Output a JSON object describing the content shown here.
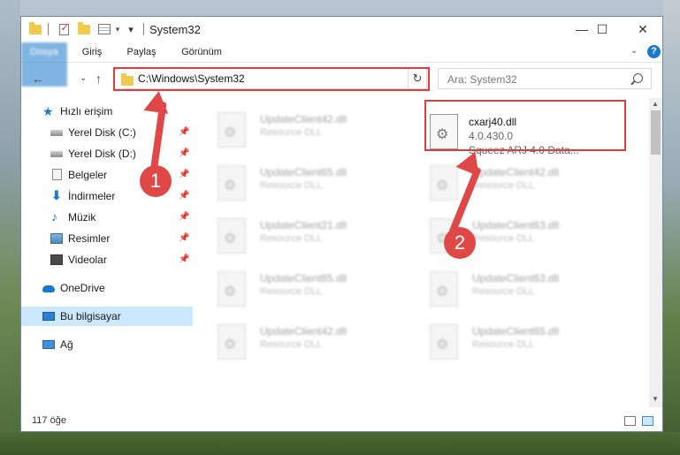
{
  "window": {
    "title": "System32"
  },
  "ribbon": {
    "tabs": [
      {
        "label": "Dosya"
      },
      {
        "label": "Giriş"
      },
      {
        "label": "Paylaş"
      },
      {
        "label": "Görünüm"
      }
    ],
    "help": "?"
  },
  "navigation": {
    "address": "C:\\Windows\\System32",
    "search_placeholder": "Ara: System32"
  },
  "sidebar": {
    "items": [
      {
        "label": "Hızlı erişim",
        "icon": "star-icon"
      },
      {
        "label": "Yerel Disk (C:)",
        "icon": "disk-icon",
        "pinned": true
      },
      {
        "label": "Yerel Disk (D:)",
        "icon": "disk-icon",
        "pinned": true
      },
      {
        "label": "Belgeler",
        "icon": "documents-icon",
        "pinned": true
      },
      {
        "label": "İndirmeler",
        "icon": "download-icon",
        "pinned": true
      },
      {
        "label": "Müzik",
        "icon": "music-icon",
        "pinned": true
      },
      {
        "label": "Resimler",
        "icon": "pictures-icon",
        "pinned": true
      },
      {
        "label": "Videolar",
        "icon": "videos-icon",
        "pinned": true
      },
      {
        "label": "OneDrive",
        "icon": "onedrive-icon"
      },
      {
        "label": "Bu bilgisayar",
        "icon": "computer-icon",
        "selected": true
      },
      {
        "label": "Ağ",
        "icon": "network-icon"
      }
    ]
  },
  "files": {
    "left_column": [
      {
        "name": "UpdateClient42.dll",
        "type": "Resource DLL"
      },
      {
        "name": "UpdateClient65.dll",
        "type": "Resource DLL"
      },
      {
        "name": "UpdateClient21.dll",
        "type": "Resource DLL"
      },
      {
        "name": "UpdateClient65.dll",
        "type": "Resource DLL"
      },
      {
        "name": "UpdateClient42.dll",
        "type": "Resource DLL"
      }
    ],
    "right_column": [
      {
        "name": "UpdateClient42.dll",
        "type": "Resource DLL"
      },
      {
        "name": "UpdateClient63.dll",
        "type": "Resource DLL"
      },
      {
        "name": "UpdateClient63.dll",
        "type": "Resource DLL"
      },
      {
        "name": "UpdateClient65.dll",
        "type": "Resource DLL"
      }
    ],
    "highlighted": {
      "name": "cxarj40.dll",
      "version": "4.0.430.0",
      "description": "Squeez ARJ 4.0 Data..."
    }
  },
  "status": {
    "count": "117 öğe"
  },
  "callouts": [
    "1",
    "2"
  ],
  "colors": {
    "accent": "#1979ca",
    "highlight": "#e23b3b",
    "callout": "#e04848"
  }
}
